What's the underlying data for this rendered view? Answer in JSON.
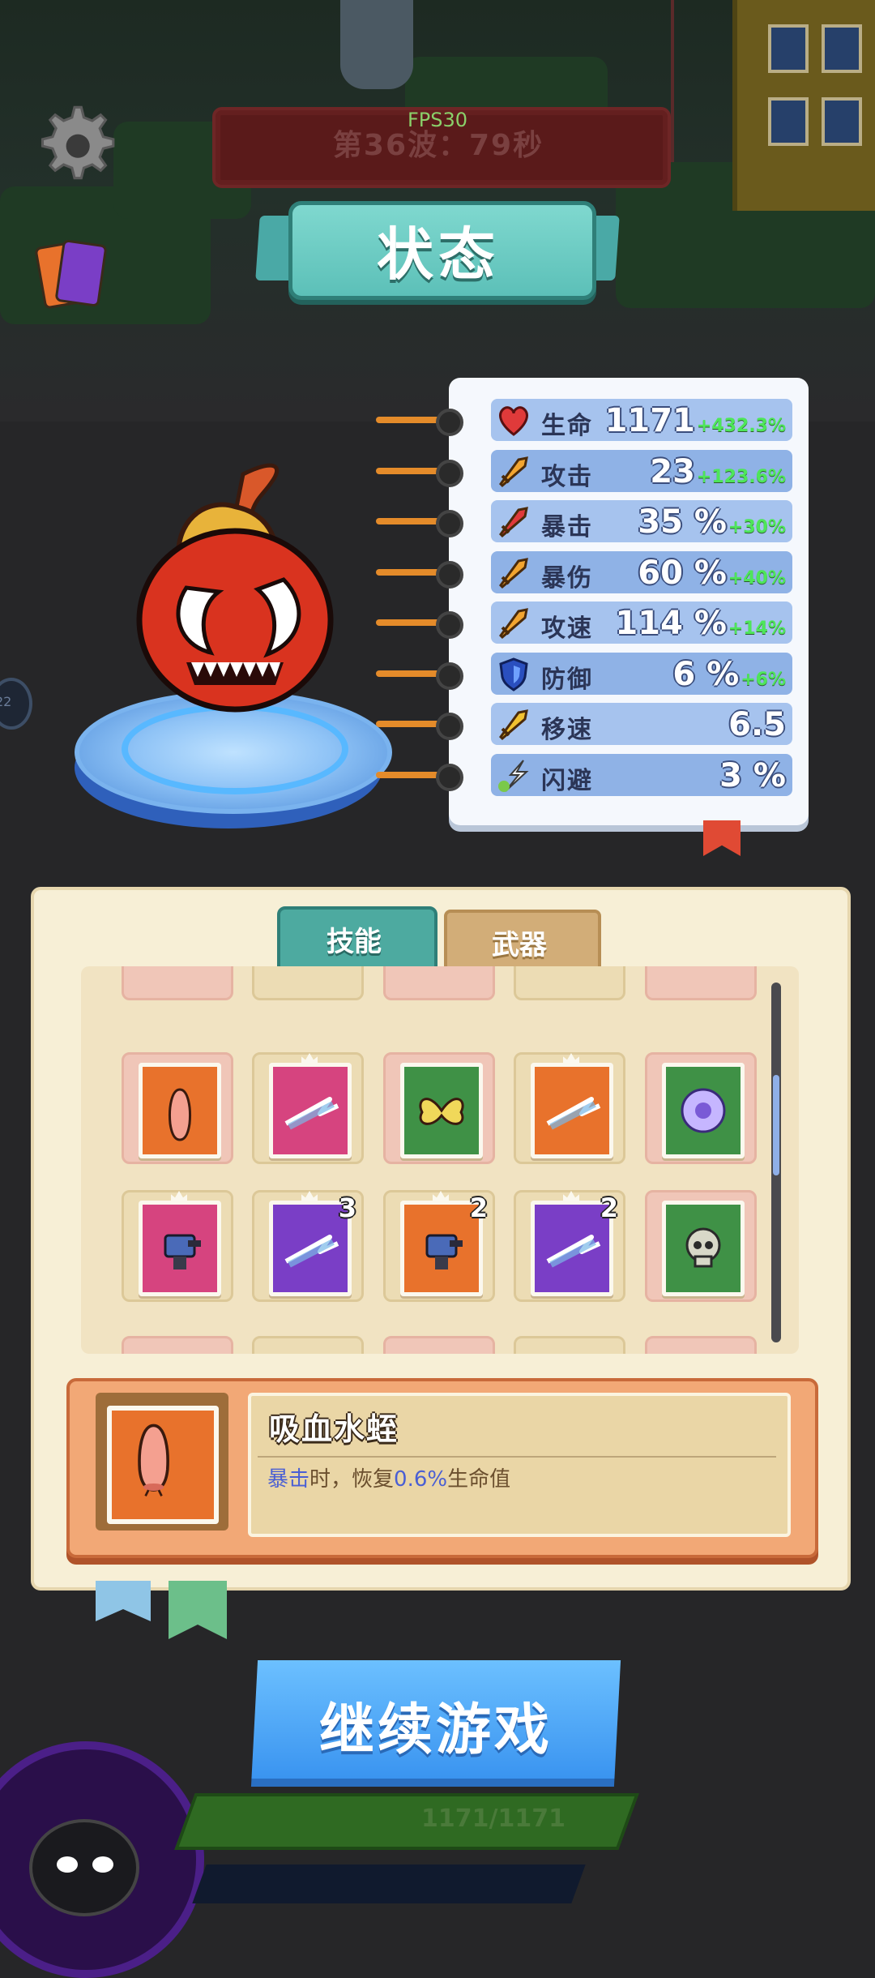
{
  "hud": {
    "fps": "FPS30",
    "wave_text": "第36波：79秒",
    "side_badge": "22"
  },
  "title": "状态",
  "stats": [
    {
      "name": "生命",
      "value": "1171",
      "bonus": "+432.3%",
      "icon": "heart-icon",
      "color": "#e03a3a"
    },
    {
      "name": "攻击",
      "value": "23",
      "bonus": "+123.6%",
      "icon": "sword-icon",
      "color": "#f2a530"
    },
    {
      "name": "暴击",
      "value": "35 %",
      "bonus": "+30%",
      "icon": "critical-icon",
      "color": "#e03a3a"
    },
    {
      "name": "暴伤",
      "value": "60 %",
      "bonus": "+40%",
      "icon": "critical-damage-icon",
      "color": "#f2a530"
    },
    {
      "name": "攻速",
      "value": "114 %",
      "bonus": "+14%",
      "icon": "attack-speed-icon",
      "color": "#f2a530"
    },
    {
      "name": "防御",
      "value": "6 %",
      "bonus": "+6%",
      "icon": "shield-icon",
      "color": "#2a4fbf"
    },
    {
      "name": "移速",
      "value": "6.5",
      "bonus": "",
      "icon": "move-speed-icon",
      "color": "#f2c230"
    },
    {
      "name": "闪避",
      "value": "3 %",
      "bonus": "",
      "icon": "dodge-icon",
      "color": "#7ac94a"
    }
  ],
  "tabs": {
    "skills": "技能",
    "weapons": "武器"
  },
  "skill_cards": [
    {
      "slot": "pink",
      "color": "orange",
      "icon": "leech-icon",
      "crown": false,
      "badge": ""
    },
    {
      "slot": "tan",
      "color": "pink",
      "icon": "lightning-blade-icon",
      "crown": true,
      "badge": ""
    },
    {
      "slot": "pink",
      "color": "green",
      "icon": "butterfly-icon",
      "crown": false,
      "badge": ""
    },
    {
      "slot": "tan",
      "color": "orange",
      "icon": "lightning-blade-iii-icon",
      "crown": true,
      "badge": ""
    },
    {
      "slot": "pink",
      "color": "green",
      "icon": "vortex-orb-icon",
      "crown": false,
      "badge": ""
    },
    {
      "slot": "tan",
      "color": "pink",
      "icon": "turret-icon",
      "crown": true,
      "badge": ""
    },
    {
      "slot": "tan",
      "color": "purple",
      "icon": "lightning-blade-ii-icon",
      "crown": true,
      "badge": "3"
    },
    {
      "slot": "tan",
      "color": "orange",
      "icon": "turret-iii-icon",
      "crown": true,
      "badge": "2"
    },
    {
      "slot": "tan",
      "color": "purple",
      "icon": "lightning-blade-iv-icon",
      "crown": true,
      "badge": "2"
    },
    {
      "slot": "pink",
      "color": "green",
      "icon": "skull-icon",
      "crown": false,
      "badge": ""
    }
  ],
  "detail": {
    "title": "吸血水蛭",
    "desc_keyword": "暴击",
    "desc_mid": "时，恢复",
    "desc_value": "0.6%",
    "desc_end": "生命值"
  },
  "continue_button": "继续游戏",
  "hp": "1171/1171"
}
